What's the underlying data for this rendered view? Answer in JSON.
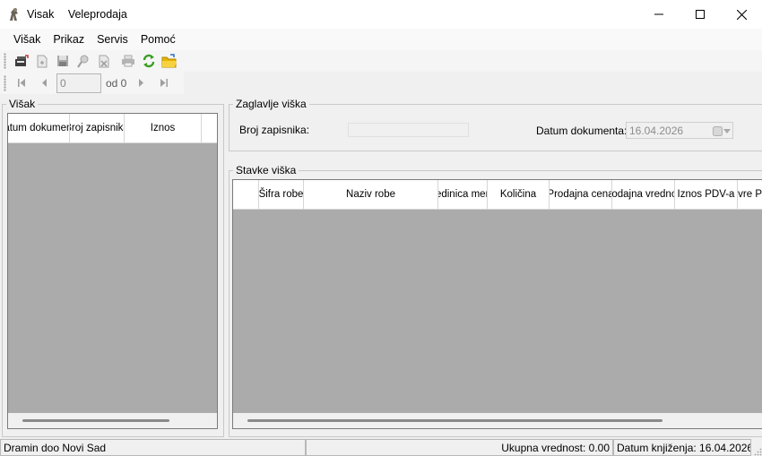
{
  "window": {
    "app_name": "Visak",
    "title": "Veleprodaja"
  },
  "menu": {
    "items": [
      "Višak",
      "Prikaz",
      "Servis",
      "Pomoć"
    ]
  },
  "navigator": {
    "position": "0",
    "of_label": "od 0"
  },
  "left_panel": {
    "title": "Višak",
    "columns": [
      "Datum dokumenta",
      "Broj zapisnika",
      "Iznos"
    ]
  },
  "header_panel": {
    "title": "Zaglavlje viška",
    "doc_number_label": "Broj zapisnika:",
    "doc_number_value": "",
    "doc_date_label": "Datum dokumenta:",
    "doc_date_value": "16.04.2026"
  },
  "items_panel": {
    "title": "Stavke viška",
    "columns": [
      "Šifra robe",
      "Naziv robe",
      "Jedinica mere",
      "Količina",
      "Prodajna cena",
      "Prodajna vrednost",
      "Iznos PDV-a",
      "Pr vre P"
    ]
  },
  "status": {
    "company": "Dramin doo Novi Sad",
    "total": "Ukupna vrednost: 0.00",
    "posting_date": "Datum knjiženja: 16.04.2026"
  },
  "colors": {
    "grid_background": "#ababab",
    "header_background": "#ffffff",
    "refresh_icon": "#3a9d23",
    "folder_icon": "#e8b400"
  }
}
